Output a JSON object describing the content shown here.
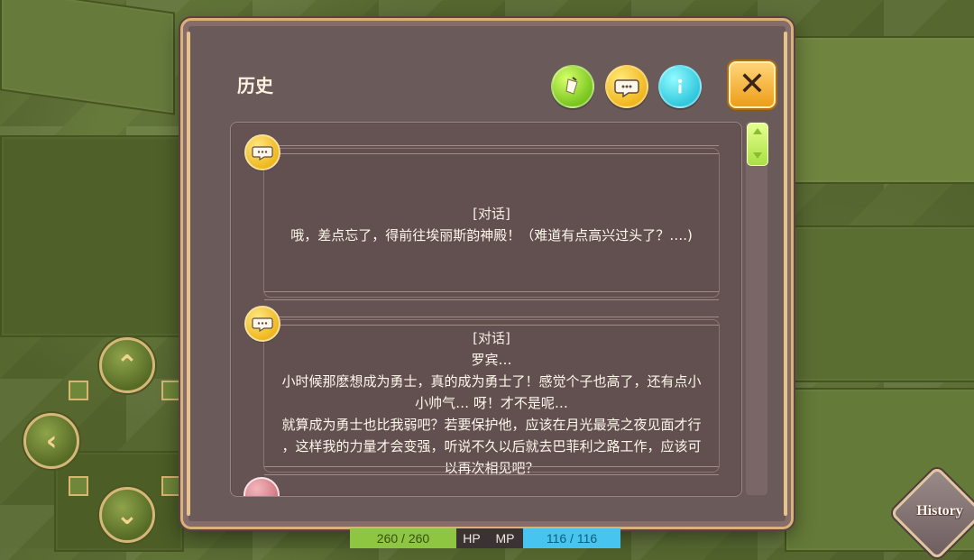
{
  "window": {
    "title": "历史"
  },
  "top_buttons": {
    "quest_icon": "quest-scroll-icon",
    "dialog_icon": "speech-bubble-icon",
    "info_icon": "info-icon",
    "close_symbol": "✕"
  },
  "entries": [
    {
      "label": "[对话]",
      "lines": [
        "哦，差点忘了，得前往埃丽斯韵神殿！（难道有点高兴过头了？….)"
      ]
    },
    {
      "label": "[对话]",
      "lines": [
        "罗宾…",
        "小时候那麽想成为勇士，真的成为勇士了！感觉个子也高了，还有点小",
        "小帅气… 呀！才不是呢…",
        "就算成为勇士也比我弱吧？若要保护他，应该在月光最亮之夜见面才行",
        "，这样我的力量才会变强，听说不久以后就去巴菲利之路工作，应该可",
        "以再次相见吧？"
      ]
    }
  ],
  "history_button": {
    "label": "History"
  },
  "status": {
    "hp_value": "260 / 260",
    "hp_label": "HP",
    "mp_label": "MP",
    "mp_value": "116 / 116"
  },
  "colors": {
    "window_bg": "#6b5a5a",
    "accent_gold": "#d8b27a",
    "quest_green": "#78c51e",
    "dialog_yellow": "#f0b61f",
    "info_cyan": "#31c7dd",
    "close_orange": "#ee9d18"
  }
}
